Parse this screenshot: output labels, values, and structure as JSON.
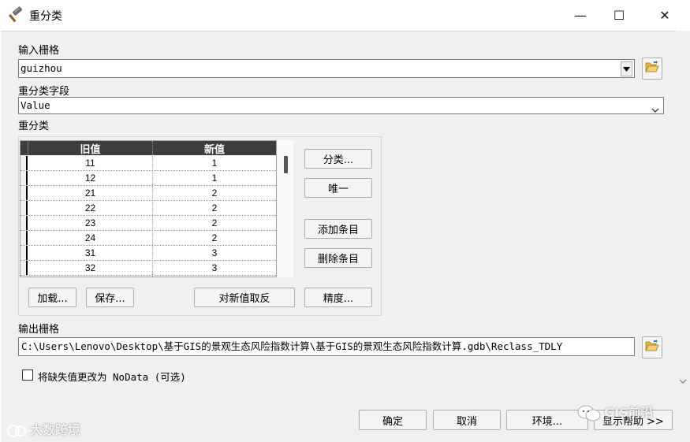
{
  "window": {
    "title": "重分类",
    "minimize_glyph": "—",
    "maximize_glyph": "☐",
    "close_glyph": "✕"
  },
  "input_raster": {
    "label": "输入栅格",
    "value": "guizhou"
  },
  "reclass_field": {
    "label": "重分类字段",
    "value": "Value"
  },
  "reclassification": {
    "label": "重分类",
    "columns": [
      "旧值",
      "新值"
    ],
    "rows": [
      {
        "old": "11",
        "new": "1"
      },
      {
        "old": "12",
        "new": "1"
      },
      {
        "old": "21",
        "new": "2"
      },
      {
        "old": "22",
        "new": "2"
      },
      {
        "old": "23",
        "new": "2"
      },
      {
        "old": "24",
        "new": "2"
      },
      {
        "old": "31",
        "new": "3"
      },
      {
        "old": "32",
        "new": "3"
      }
    ],
    "buttons": {
      "classify": "分类...",
      "unique": "唯一",
      "add_entry": "添加条目",
      "delete_entry": "删除条目",
      "load": "加载...",
      "save": "保存...",
      "reverse": "对新值取反",
      "precision": "精度..."
    }
  },
  "output_raster": {
    "label": "输出栅格",
    "value": "C:\\Users\\Lenovo\\Desktop\\基于GIS的景观生态风险指数计算\\基于GIS的景观生态风险指数计算.gdb\\Reclass_TDLY"
  },
  "nodata_option": {
    "label": "将缺失值更改为 NoData (可选)",
    "checked": false
  },
  "footer": {
    "ok": "确定",
    "cancel": "取消",
    "environments": "环境...",
    "show_help": "显示帮助 >>"
  },
  "watermarks": {
    "left": "大数跨境",
    "right": "GIS前沿"
  },
  "icons": {
    "title": "hammer-icon",
    "browse": "folder-open-icon",
    "dropdown": "chevron-down-icon"
  }
}
